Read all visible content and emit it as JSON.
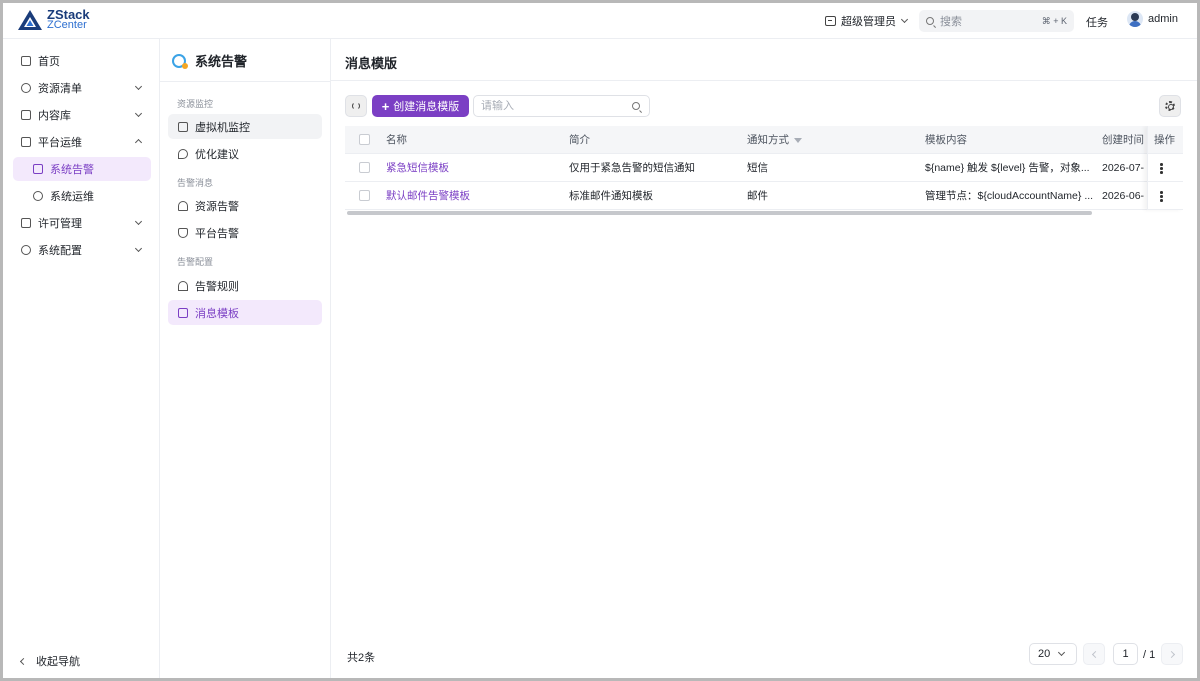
{
  "brand": {
    "line1": "ZStack",
    "line2": "ZCenter"
  },
  "topbar": {
    "role": "超级管理员",
    "search_placeholder": "搜索",
    "search_shortcut": "⌘ + K",
    "tasks": "任务",
    "user": "admin"
  },
  "nav": {
    "items": [
      {
        "label": "首页",
        "icon": "home-icon"
      },
      {
        "label": "资源清单",
        "icon": "globe-icon"
      },
      {
        "label": "内容库",
        "icon": "library-icon"
      },
      {
        "label": "平台运维",
        "icon": "inbox-icon"
      },
      {
        "label": "系统告警",
        "icon": "alert-doc-icon"
      },
      {
        "label": "系统运维",
        "icon": "clock-icon"
      },
      {
        "label": "许可管理",
        "icon": "license-icon"
      },
      {
        "label": "系统配置",
        "icon": "gear-icon"
      }
    ],
    "collapse_label": "收起导航"
  },
  "subnav": {
    "title": "系统告警",
    "groups": [
      {
        "label": "资源监控",
        "items": [
          "虚拟机监控",
          "优化建议"
        ]
      },
      {
        "label": "告警消息",
        "items": [
          "资源告警",
          "平台告警"
        ]
      },
      {
        "label": "告警配置",
        "items": [
          "告警规则",
          "消息模板"
        ]
      }
    ]
  },
  "main": {
    "title": "消息模版",
    "create_label": "创建消息模版",
    "search_placeholder": "请输入",
    "columns": [
      "名称",
      "简介",
      "通知方式",
      "模板内容",
      "创建时间",
      "操作"
    ],
    "rows": [
      {
        "name": "紧急短信模板",
        "desc": "仅用于紧急告警的短信通知",
        "method": "短信",
        "content": "${name} 触发 ${level} 告警，对象...",
        "created": "2026-07-"
      },
      {
        "name": "默认邮件告警模板",
        "desc": "标准邮件通知模板",
        "method": "邮件",
        "content": "管理节点：${cloudAccountName} ...",
        "created": "2026-06-"
      }
    ],
    "total": "共2条",
    "page_size": "20",
    "current_page": "1",
    "page_total": "/ 1"
  },
  "colors": {
    "accent": "#7b3fc4",
    "brand_dark": "#1a3c7a",
    "brand_light": "#2d6fd0"
  }
}
